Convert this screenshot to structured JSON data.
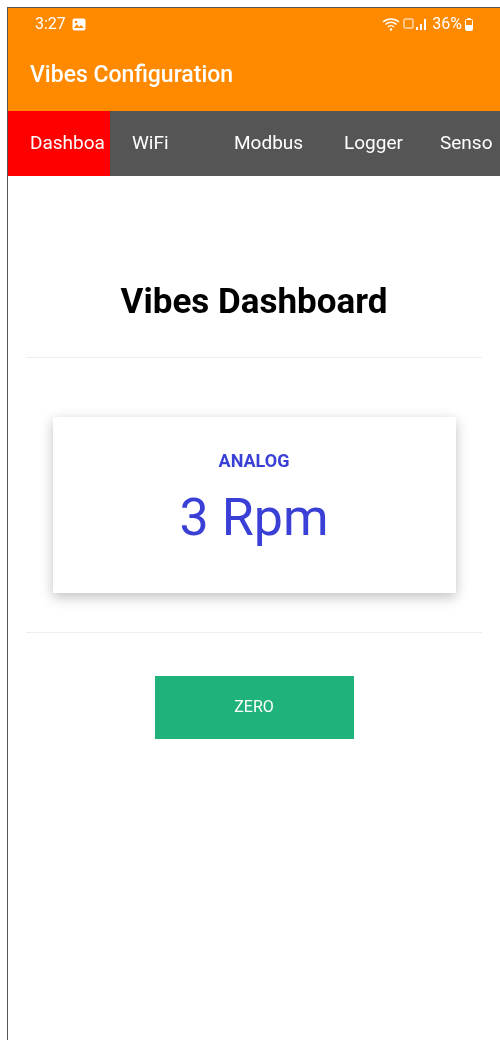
{
  "status_bar": {
    "time": "3:27",
    "battery": "36%"
  },
  "app_bar": {
    "title": "Vibes Configuration"
  },
  "tabs": [
    {
      "label": "Dashboa",
      "selected": true
    },
    {
      "label": "WiFi",
      "selected": false
    },
    {
      "label": "Modbus",
      "selected": false
    },
    {
      "label": "Logger",
      "selected": false
    },
    {
      "label": "Senso",
      "selected": false
    }
  ],
  "heading": "Vibes Dashboard",
  "card": {
    "label": "ANALOG",
    "value": "3 Rpm"
  },
  "buttons": [
    "ZERO"
  ]
}
